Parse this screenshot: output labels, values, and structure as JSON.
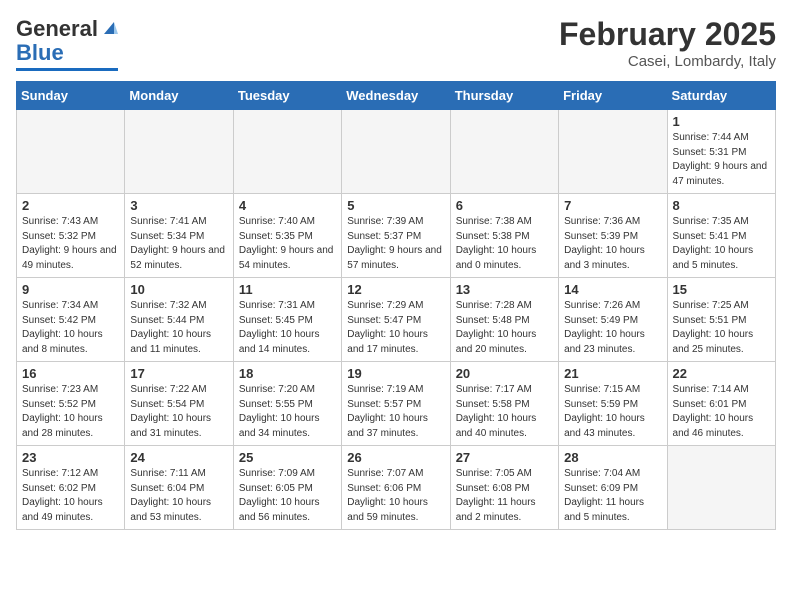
{
  "header": {
    "logo_general": "General",
    "logo_blue": "Blue",
    "month_title": "February 2025",
    "subtitle": "Casei, Lombardy, Italy"
  },
  "weekdays": [
    "Sunday",
    "Monday",
    "Tuesday",
    "Wednesday",
    "Thursday",
    "Friday",
    "Saturday"
  ],
  "weeks": [
    [
      {
        "num": "",
        "info": ""
      },
      {
        "num": "",
        "info": ""
      },
      {
        "num": "",
        "info": ""
      },
      {
        "num": "",
        "info": ""
      },
      {
        "num": "",
        "info": ""
      },
      {
        "num": "",
        "info": ""
      },
      {
        "num": "1",
        "info": "Sunrise: 7:44 AM\nSunset: 5:31 PM\nDaylight: 9 hours and 47 minutes."
      }
    ],
    [
      {
        "num": "2",
        "info": "Sunrise: 7:43 AM\nSunset: 5:32 PM\nDaylight: 9 hours and 49 minutes."
      },
      {
        "num": "3",
        "info": "Sunrise: 7:41 AM\nSunset: 5:34 PM\nDaylight: 9 hours and 52 minutes."
      },
      {
        "num": "4",
        "info": "Sunrise: 7:40 AM\nSunset: 5:35 PM\nDaylight: 9 hours and 54 minutes."
      },
      {
        "num": "5",
        "info": "Sunrise: 7:39 AM\nSunset: 5:37 PM\nDaylight: 9 hours and 57 minutes."
      },
      {
        "num": "6",
        "info": "Sunrise: 7:38 AM\nSunset: 5:38 PM\nDaylight: 10 hours and 0 minutes."
      },
      {
        "num": "7",
        "info": "Sunrise: 7:36 AM\nSunset: 5:39 PM\nDaylight: 10 hours and 3 minutes."
      },
      {
        "num": "8",
        "info": "Sunrise: 7:35 AM\nSunset: 5:41 PM\nDaylight: 10 hours and 5 minutes."
      }
    ],
    [
      {
        "num": "9",
        "info": "Sunrise: 7:34 AM\nSunset: 5:42 PM\nDaylight: 10 hours and 8 minutes."
      },
      {
        "num": "10",
        "info": "Sunrise: 7:32 AM\nSunset: 5:44 PM\nDaylight: 10 hours and 11 minutes."
      },
      {
        "num": "11",
        "info": "Sunrise: 7:31 AM\nSunset: 5:45 PM\nDaylight: 10 hours and 14 minutes."
      },
      {
        "num": "12",
        "info": "Sunrise: 7:29 AM\nSunset: 5:47 PM\nDaylight: 10 hours and 17 minutes."
      },
      {
        "num": "13",
        "info": "Sunrise: 7:28 AM\nSunset: 5:48 PM\nDaylight: 10 hours and 20 minutes."
      },
      {
        "num": "14",
        "info": "Sunrise: 7:26 AM\nSunset: 5:49 PM\nDaylight: 10 hours and 23 minutes."
      },
      {
        "num": "15",
        "info": "Sunrise: 7:25 AM\nSunset: 5:51 PM\nDaylight: 10 hours and 25 minutes."
      }
    ],
    [
      {
        "num": "16",
        "info": "Sunrise: 7:23 AM\nSunset: 5:52 PM\nDaylight: 10 hours and 28 minutes."
      },
      {
        "num": "17",
        "info": "Sunrise: 7:22 AM\nSunset: 5:54 PM\nDaylight: 10 hours and 31 minutes."
      },
      {
        "num": "18",
        "info": "Sunrise: 7:20 AM\nSunset: 5:55 PM\nDaylight: 10 hours and 34 minutes."
      },
      {
        "num": "19",
        "info": "Sunrise: 7:19 AM\nSunset: 5:57 PM\nDaylight: 10 hours and 37 minutes."
      },
      {
        "num": "20",
        "info": "Sunrise: 7:17 AM\nSunset: 5:58 PM\nDaylight: 10 hours and 40 minutes."
      },
      {
        "num": "21",
        "info": "Sunrise: 7:15 AM\nSunset: 5:59 PM\nDaylight: 10 hours and 43 minutes."
      },
      {
        "num": "22",
        "info": "Sunrise: 7:14 AM\nSunset: 6:01 PM\nDaylight: 10 hours and 46 minutes."
      }
    ],
    [
      {
        "num": "23",
        "info": "Sunrise: 7:12 AM\nSunset: 6:02 PM\nDaylight: 10 hours and 49 minutes."
      },
      {
        "num": "24",
        "info": "Sunrise: 7:11 AM\nSunset: 6:04 PM\nDaylight: 10 hours and 53 minutes."
      },
      {
        "num": "25",
        "info": "Sunrise: 7:09 AM\nSunset: 6:05 PM\nDaylight: 10 hours and 56 minutes."
      },
      {
        "num": "26",
        "info": "Sunrise: 7:07 AM\nSunset: 6:06 PM\nDaylight: 10 hours and 59 minutes."
      },
      {
        "num": "27",
        "info": "Sunrise: 7:05 AM\nSunset: 6:08 PM\nDaylight: 11 hours and 2 minutes."
      },
      {
        "num": "28",
        "info": "Sunrise: 7:04 AM\nSunset: 6:09 PM\nDaylight: 11 hours and 5 minutes."
      },
      {
        "num": "",
        "info": ""
      }
    ]
  ]
}
